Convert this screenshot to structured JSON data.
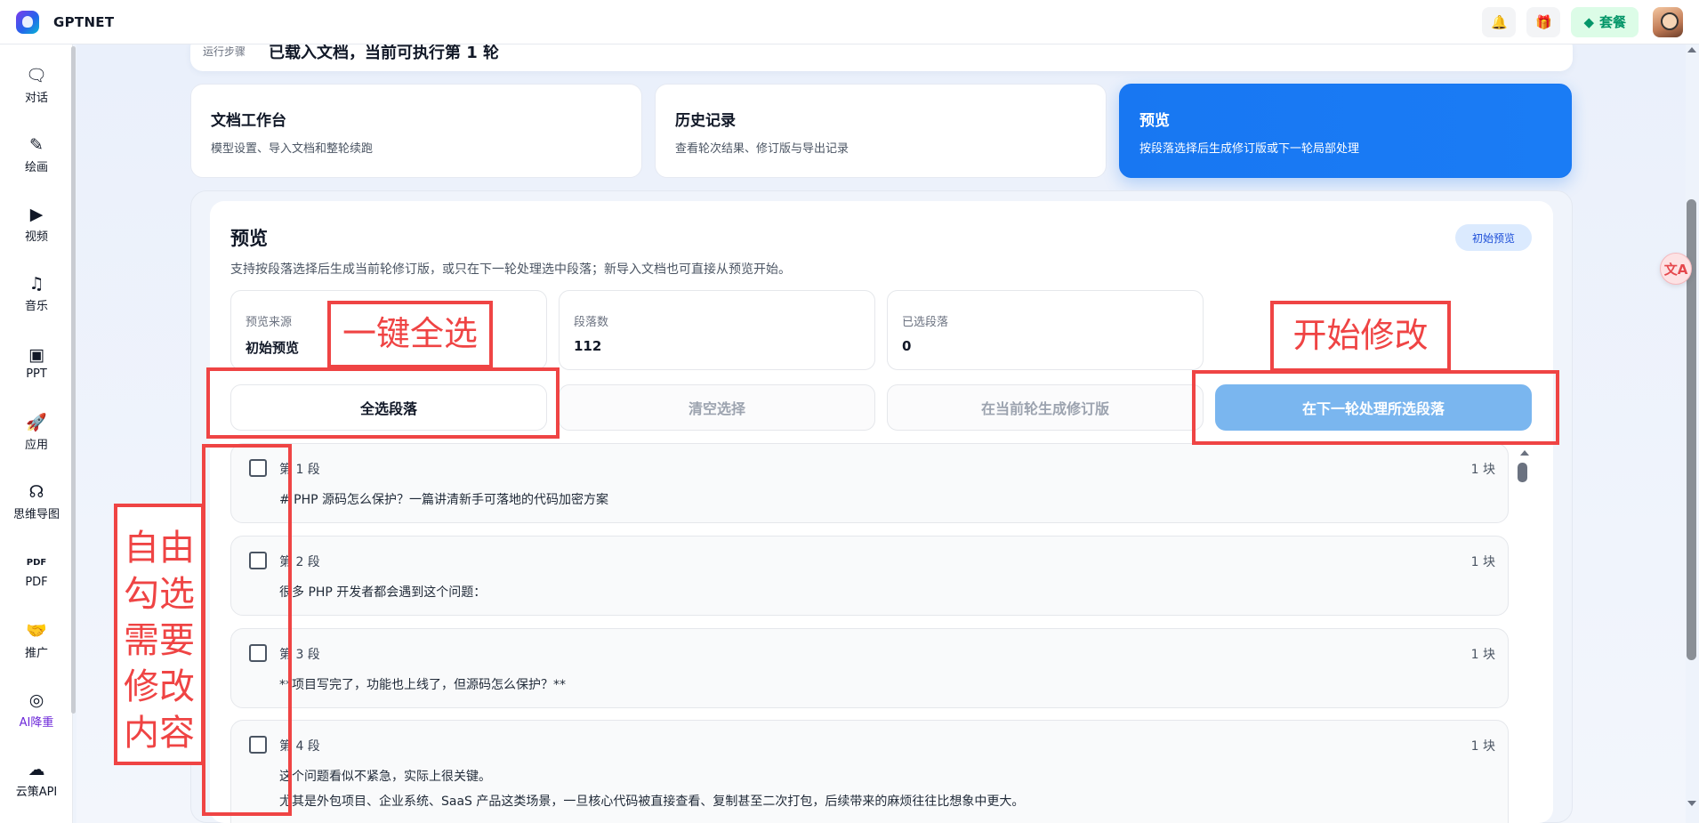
{
  "app": {
    "brand": "GPTNET"
  },
  "topbar": {
    "plan_label": "套餐"
  },
  "sidebar": {
    "items": [
      {
        "label": "对话",
        "icon": "chat-icon",
        "glyph": "🗨"
      },
      {
        "label": "绘画",
        "icon": "brush-icon",
        "glyph": "✎"
      },
      {
        "label": "视频",
        "icon": "video-icon",
        "glyph": "▶"
      },
      {
        "label": "音乐",
        "icon": "music-icon",
        "glyph": "♫"
      },
      {
        "label": "PPT",
        "icon": "presentation-icon",
        "glyph": "▣"
      },
      {
        "label": "应用",
        "icon": "rocket-icon",
        "glyph": "🚀"
      },
      {
        "label": "思维导图",
        "icon": "mindmap-icon",
        "glyph": "☊"
      },
      {
        "label": "PDF",
        "icon": "pdf-icon",
        "glyph": "PDF"
      },
      {
        "label": "推广",
        "icon": "handshake-icon",
        "glyph": "🤝"
      },
      {
        "label": "AI降重",
        "icon": "ai-reduce-icon",
        "glyph": "◎"
      },
      {
        "label": "云策API",
        "icon": "cloud-api-icon",
        "glyph": "☁"
      }
    ]
  },
  "run": {
    "label": "运行步骤",
    "status": "已载入文档，当前可执行第 1 轮"
  },
  "cards": [
    {
      "title": "文档工作台",
      "subtitle": "模型设置、导入文档和整轮续跑"
    },
    {
      "title": "历史记录",
      "subtitle": "查看轮次结果、修订版与导出记录"
    },
    {
      "title": "预览",
      "subtitle": "按段落选择后生成修订版或下一轮局部处理"
    }
  ],
  "preview": {
    "title": "预览",
    "subtitle": "支持按段落选择后生成当前轮修订版，或只在下一轮处理选中段落；新导入文档也可直接从预览开始。",
    "badge": "初始预览",
    "stats": [
      {
        "label": "预览来源",
        "value": "初始预览"
      },
      {
        "label": "段落数",
        "value": "112"
      },
      {
        "label": "已选段落",
        "value": "0"
      }
    ],
    "buttons": {
      "select_all": "全选段落",
      "clear": "清空选择",
      "gen_revision": "在当前轮生成修订版",
      "process_next": "在下一轮处理所选段落"
    },
    "paragraphs": [
      {
        "num": "第 1 段",
        "count": "1 块",
        "text": "# PHP 源码怎么保护？一篇讲清新手可落地的代码加密方案"
      },
      {
        "num": "第 2 段",
        "count": "1 块",
        "text": "很多 PHP 开发者都会遇到这个问题："
      },
      {
        "num": "第 3 段",
        "count": "1 块",
        "text": "**项目写完了，功能也上线了，但源码怎么保护？**"
      },
      {
        "num": "第 4 段",
        "count": "1 块",
        "text": "这个问题看似不紧急，实际上很关键。",
        "text2": "尤其是外包项目、企业系统、SaaS 产品这类场景，一旦核心代码被直接查看、复制甚至二次打包，后续带来的麻烦往往比想象中更大。"
      }
    ]
  },
  "annotations": {
    "select_all": "一键全选",
    "start_edit": "开始修改",
    "free_select": [
      "自由",
      "勾选",
      "需要",
      "修改",
      "内容"
    ]
  },
  "colors": {
    "accent": "#1877f2",
    "annotation": "#ef4444",
    "plan": "#059669"
  }
}
